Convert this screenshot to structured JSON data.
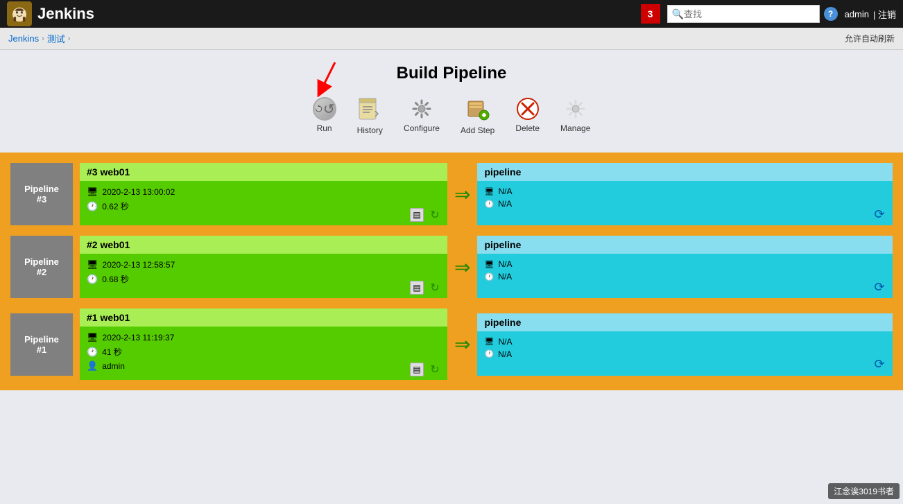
{
  "header": {
    "title": "Jenkins",
    "notification_count": "3",
    "search_placeholder": "查找",
    "help_label": "?",
    "user": "admin",
    "logout": "| 注销"
  },
  "breadcrumb": {
    "jenkins": "Jenkins",
    "arrow1": "›",
    "test": "测试",
    "arrow2": "›",
    "auto_refresh": "允许自动刷新"
  },
  "pipeline": {
    "title": "Build Pipeline",
    "toolbar": [
      {
        "id": "run",
        "label": "Run"
      },
      {
        "id": "history",
        "label": "History"
      },
      {
        "id": "configure",
        "label": "Configure"
      },
      {
        "id": "add-step",
        "label": "Add Step"
      },
      {
        "id": "delete",
        "label": "Delete"
      },
      {
        "id": "manage",
        "label": "Manage"
      }
    ],
    "rows": [
      {
        "label": "Pipeline",
        "number": "#3",
        "build_title": "#3 web01",
        "build_date": "2020-2-13 13:00:02",
        "build_duration": "0.62 秒",
        "pipeline_title": "pipeline",
        "na1": "N/A",
        "na2": "N/A"
      },
      {
        "label": "Pipeline",
        "number": "#2",
        "build_title": "#2 web01",
        "build_date": "2020-2-13 12:58:57",
        "build_duration": "0.68 秒",
        "pipeline_title": "pipeline",
        "na1": "N/A",
        "na2": "N/A"
      },
      {
        "label": "Pipeline",
        "number": "#1",
        "build_title": "#1 web01",
        "build_date": "2020-2-13 11:19:37",
        "build_duration": "41 秒",
        "build_user": "admin",
        "pipeline_title": "pipeline",
        "na1": "N/A",
        "na2": "N/A"
      }
    ]
  },
  "watermark": "江念诶3019书者"
}
